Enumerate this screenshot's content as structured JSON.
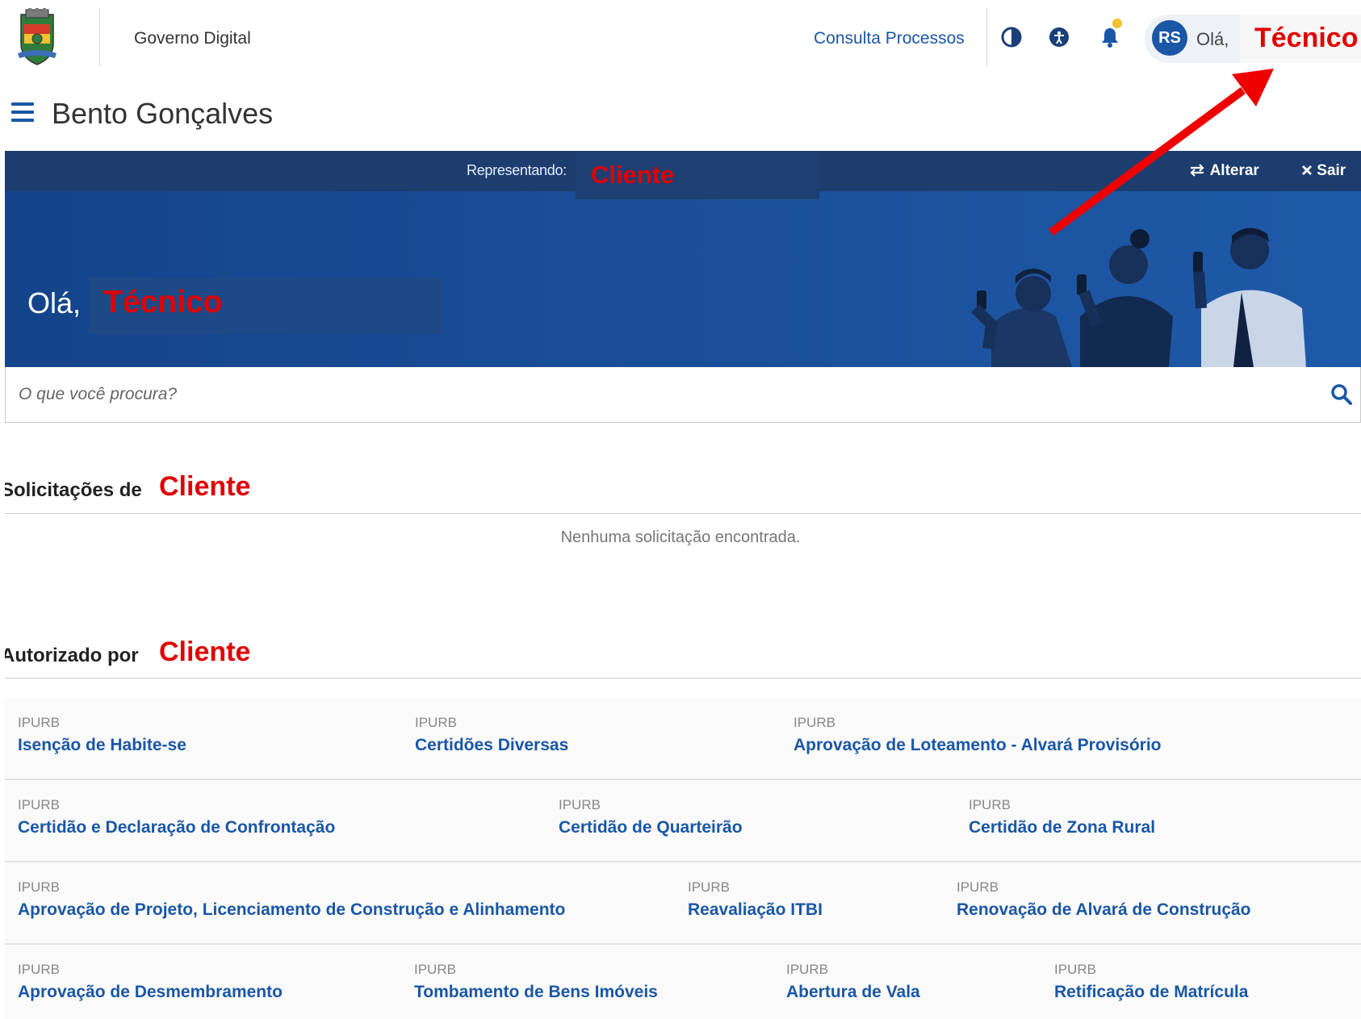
{
  "header": {
    "org_title": "Governo Digital",
    "consulta_link": "Consulta Processos",
    "avatar_initials": "RS",
    "greeting_short": "Olá,",
    "user_name_annotation": "Técnico"
  },
  "city": {
    "name": "Bento Gonçalves"
  },
  "banner": {
    "representing_label": "Representando:",
    "representing_annotation": "Cliente",
    "change_label": "Alterar",
    "exit_label": "Sair",
    "greeting": "Olá,",
    "name_annotation": "Técnico"
  },
  "search": {
    "placeholder": "O que você procura?"
  },
  "requests": {
    "title": "Solicitações de",
    "annotation": "Cliente",
    "empty_text": "Nenhuma solicitação encontrada."
  },
  "authorized": {
    "title": "Autorizado por",
    "annotation": "Cliente",
    "rows": [
      [
        {
          "org": "IPURB",
          "name": "Isenção de Habite-se"
        },
        {
          "org": "IPURB",
          "name": "Certidões Diversas"
        },
        {
          "org": "IPURB",
          "name": "Aprovação de Loteamento - Alvará Provisório"
        }
      ],
      [
        {
          "org": "IPURB",
          "name": "Certidão e Declaração de Confrontação"
        },
        {
          "org": "IPURB",
          "name": "Certidão de Quarteirão"
        },
        {
          "org": "IPURB",
          "name": "Certidão de Zona Rural"
        }
      ],
      [
        {
          "org": "IPURB",
          "name": "Aprovação de Projeto, Licenciamento de Construção e Alinhamento"
        },
        {
          "org": "IPURB",
          "name": "Reavaliação ITBI"
        },
        {
          "org": "IPURB",
          "name": "Renovação de Alvará de Construção"
        }
      ],
      [
        {
          "org": "IPURB",
          "name": "Aprovação de Desmembramento"
        },
        {
          "org": "IPURB",
          "name": "Tombamento de Bens Imóveis"
        },
        {
          "org": "IPURB",
          "name": "Abertura de Vala"
        },
        {
          "org": "IPURB",
          "name": "Retificação de Matrícula"
        }
      ]
    ]
  },
  "colors": {
    "brand_blue": "#1a57a6",
    "banner_dark": "#1c3d6e",
    "annotation_red": "#e00000"
  },
  "icons": [
    "crest-logo",
    "contrast-icon",
    "accessibility-icon",
    "bell-icon",
    "menu-icon",
    "swap-icon",
    "close-icon",
    "search-icon",
    "people-illustration",
    "annotation-arrow"
  ]
}
